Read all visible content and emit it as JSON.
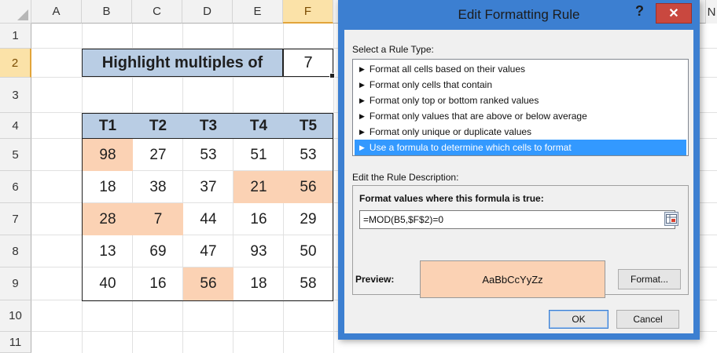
{
  "spreadsheet": {
    "columns": [
      "A",
      "B",
      "C",
      "D",
      "E",
      "F"
    ],
    "extra_column": "N",
    "rows": [
      "1",
      "2",
      "3",
      "4",
      "5",
      "6",
      "7",
      "8",
      "9",
      "10",
      "11"
    ],
    "title_label": "Highlight multiples of",
    "multiple_value": "7",
    "table": {
      "headers": [
        "T1",
        "T2",
        "T3",
        "T4",
        "T5"
      ],
      "rows": [
        [
          "98",
          "27",
          "53",
          "51",
          "53"
        ],
        [
          "18",
          "38",
          "37",
          "21",
          "56"
        ],
        [
          "28",
          "7",
          "44",
          "16",
          "29"
        ],
        [
          "13",
          "69",
          "47",
          "93",
          "50"
        ],
        [
          "40",
          "16",
          "56",
          "18",
          "58"
        ]
      ]
    },
    "highlight_color": "#fbd2b4",
    "header_fill_color": "#b9cde4"
  },
  "dialog": {
    "title": "Edit Formatting Rule",
    "help_label": "?",
    "close_label": "✕",
    "select_rule_type_label": "Select a Rule Type:",
    "rule_types": [
      "Format all cells based on their values",
      "Format only cells that contain",
      "Format only top or bottom ranked values",
      "Format only values that are above or below average",
      "Format only unique or duplicate values",
      "Use a formula to determine which cells to format"
    ],
    "selected_rule_index": 5,
    "edit_description_label": "Edit the Rule Description:",
    "formula_heading": "Format values where this formula is true:",
    "formula_value": "=MOD(B5,$F$2)=0",
    "preview_label": "Preview:",
    "preview_text": "AaBbCcYyZz",
    "format_button": "Format...",
    "ok_button": "OK",
    "cancel_button": "Cancel",
    "accent_color": "#3c7fd1"
  }
}
